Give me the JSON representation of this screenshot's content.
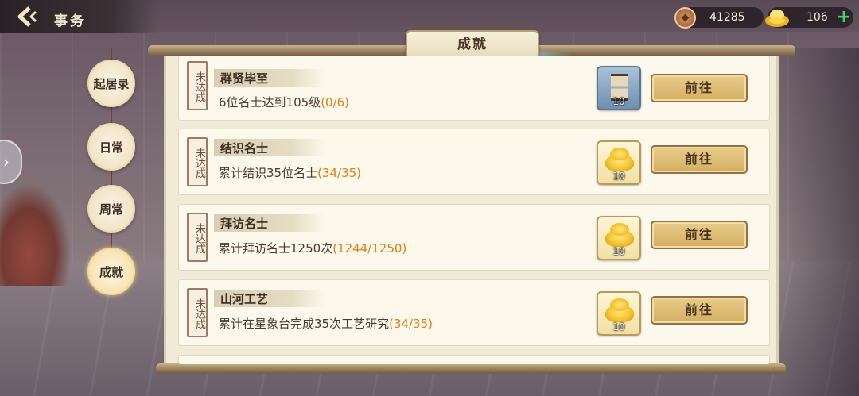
{
  "header": {
    "title": "事务",
    "coins": "41285",
    "gold": "106",
    "plus_label": "+"
  },
  "panel_title": "成就",
  "tabs": [
    {
      "label": "起居录",
      "active": false
    },
    {
      "label": "日常",
      "active": false
    },
    {
      "label": "周常",
      "active": false
    },
    {
      "label": "成就",
      "active": true
    }
  ],
  "achievements": [
    {
      "status": "未达成",
      "name": "群贤毕至",
      "desc": "6位名士达到105级",
      "progress": "(0/6)",
      "reward_icon": "hourglass-icon",
      "reward_count": "10",
      "button": "前往"
    },
    {
      "status": "未达成",
      "name": "结识名士",
      "desc": "累计结识35位名士",
      "progress": "(34/35)",
      "reward_icon": "gold-ingot-icon",
      "reward_count": "10",
      "button": "前往"
    },
    {
      "status": "未达成",
      "name": "拜访名士",
      "desc": "累计拜访名士1250次",
      "progress": "(1244/1250)",
      "reward_icon": "gold-ingot-icon",
      "reward_count": "10",
      "button": "前往"
    },
    {
      "status": "未达成",
      "name": "山河工艺",
      "desc": "累计在星象台完成35次工艺研究",
      "progress": "(34/35)",
      "reward_icon": "gold-ingot-icon",
      "reward_count": "10",
      "button": "前往"
    }
  ],
  "colors": {
    "progress": "#e17f17",
    "plus": "#4bd36a"
  }
}
